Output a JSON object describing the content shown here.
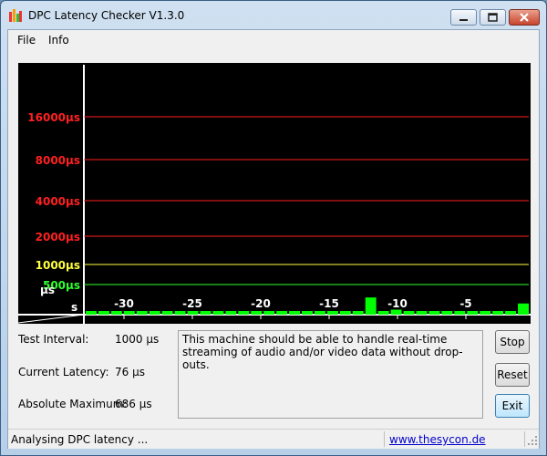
{
  "window": {
    "title": "DPC Latency Checker V1.3.0"
  },
  "menu": {
    "items": [
      "File",
      "Info"
    ]
  },
  "graph": {
    "y_ticks": [
      {
        "label": "16000µs",
        "color": "#ff2020"
      },
      {
        "label": "8000µs",
        "color": "#ff2020"
      },
      {
        "label": "4000µs",
        "color": "#ff2020"
      },
      {
        "label": "2000µs",
        "color": "#ff2020"
      },
      {
        "label": "1000µs",
        "color": "#ffff40"
      },
      {
        "label": "500µs",
        "color": "#30ff30"
      }
    ],
    "corner_top": "µs",
    "corner_bottom": "s",
    "x_ticks": [
      "-30",
      "-25",
      "-20",
      "-15",
      "-10",
      "-5"
    ],
    "bar_color": "#00ff00",
    "bars_us": [
      70,
      70,
      75,
      70,
      140,
      70,
      70,
      70,
      70,
      80,
      80,
      90,
      70,
      200,
      90,
      70,
      60,
      65,
      80,
      80,
      85,
      70,
      320,
      85,
      210,
      65,
      70,
      75,
      100,
      70,
      90,
      70,
      110,
      70,
      260
    ]
  },
  "stats": {
    "test_interval_label": "Test Interval:",
    "test_interval_value": "1000 µs",
    "current_latency_label": "Current Latency:",
    "current_latency_value": "76 µs",
    "absolute_maximum_label": "Absolute Maximum:",
    "absolute_maximum_value": "686 µs"
  },
  "message": "This machine should be able to handle real-time streaming of audio and/or video data without drop-outs.",
  "buttons": {
    "stop": "Stop",
    "reset": "Reset",
    "exit": "Exit"
  },
  "status": {
    "text": "Analysing DPC latency ...",
    "link": "www.thesycon.de"
  }
}
